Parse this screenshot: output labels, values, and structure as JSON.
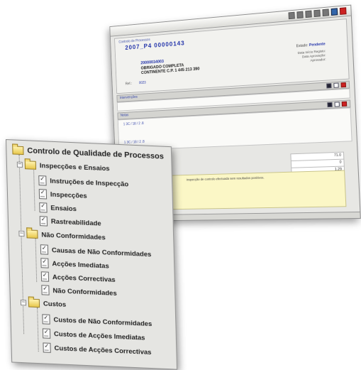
{
  "app_window": {
    "record_small": "Controlo de Processos",
    "record_number": "2007_P4   00000143",
    "record_id": "20000034003",
    "record_name": "OBRIGADO COMPLETA",
    "record_address": "CONTINENTE C.P. 1 445 213 390",
    "status_label": "Estado",
    "status_value": "Pendente",
    "fields": [
      "Data Início Registo:",
      "Data Aprovação:",
      "Aprovador:"
    ],
    "ref_label": "Ref.:",
    "ref_value": "0023",
    "section1_title": "Intervenções",
    "section2_title": "Notas",
    "section2_line1": "1 3C / 18 / 2 .8",
    "section2_line2": "1 3C / 18 / 2 .8",
    "values": [
      "71.0",
      "0",
      "1.29"
    ],
    "notes_text": "Inspecção de controlo efectuada sem resultados positivos."
  },
  "tree": {
    "root": "Controlo de Qualidade de Processos",
    "groups": [
      {
        "label": "Inspecções e Ensaios",
        "items": [
          "Instruções de Inspecção",
          "Inspecções",
          "Ensaios",
          "Rastreabilidade"
        ]
      },
      {
        "label": "Não Conformidades",
        "items": [
          "Causas de Não Conformidades",
          "Acções Imediatas",
          "Acções Correctivas",
          "Não Conformidades"
        ]
      },
      {
        "label": "Custos",
        "items": [
          "Custos de Não Conformidades",
          "Custos de Acções Imediatas",
          "Custos de Acções Correctivas"
        ]
      }
    ],
    "expander_symbol": "−"
  }
}
